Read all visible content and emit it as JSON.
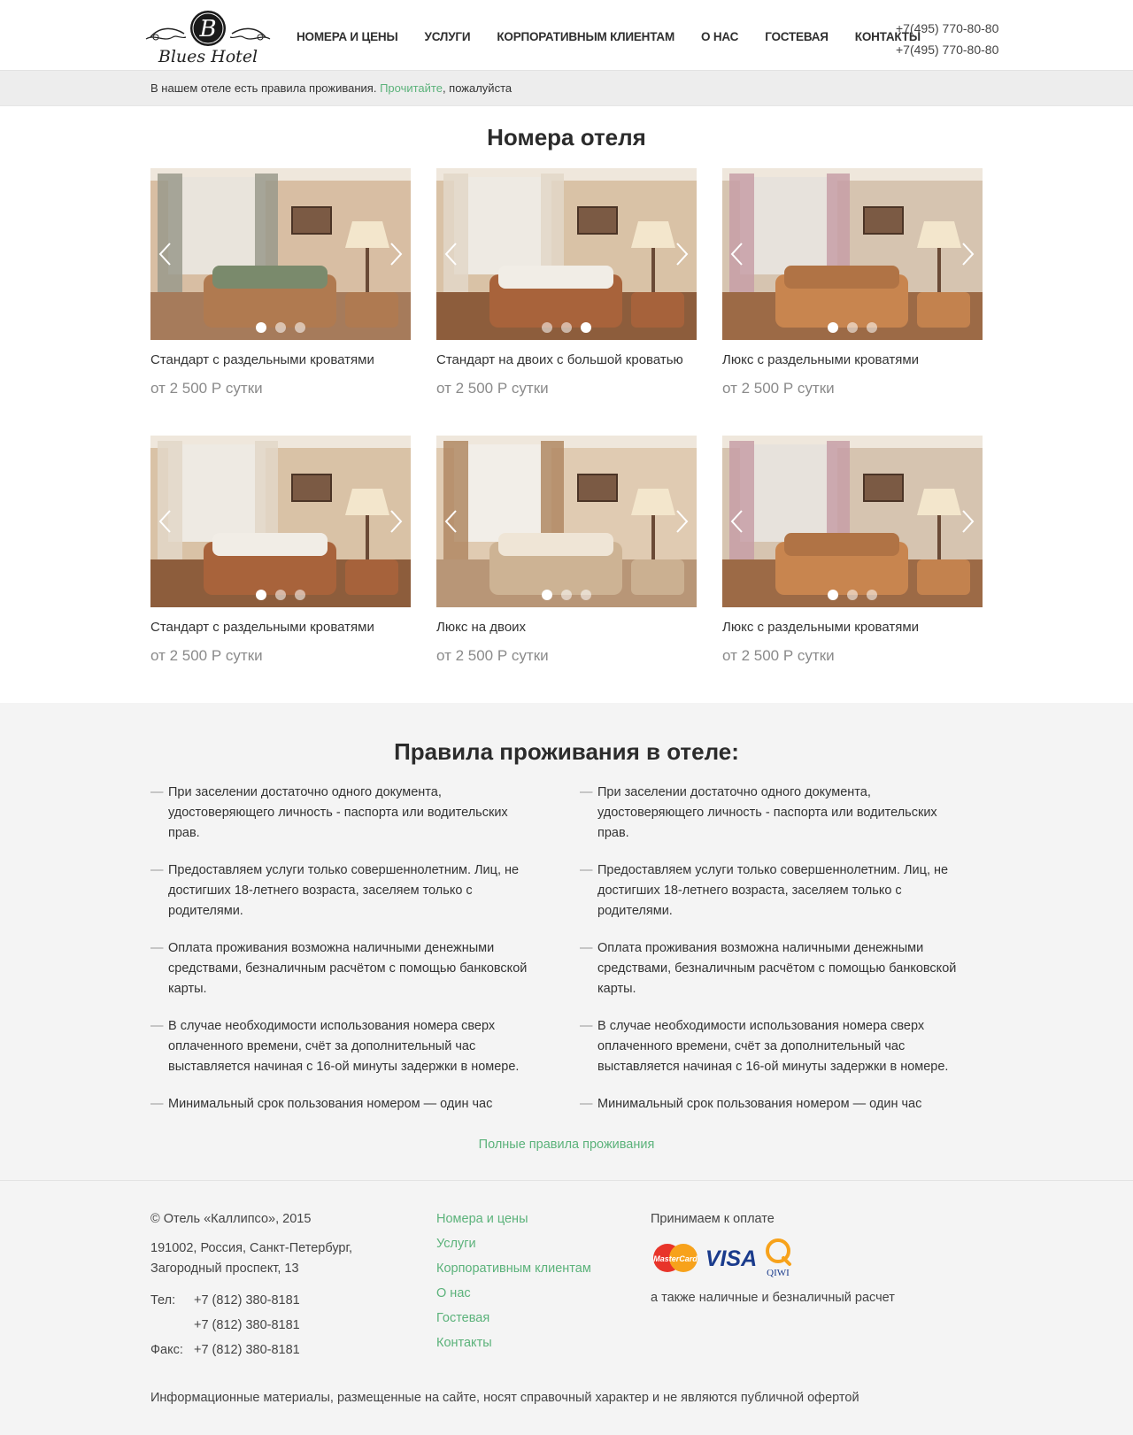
{
  "header": {
    "logo_text": "Blues Hotel",
    "logo_letter": "B",
    "nav": [
      {
        "label": "Номера и цены"
      },
      {
        "label": "Услуги"
      },
      {
        "label": "Корпоративным клиентам"
      },
      {
        "label": "О нас"
      },
      {
        "label": "Гостевая"
      },
      {
        "label": "Контакты"
      }
    ],
    "phones": [
      "+7(495) 770-80-80",
      "+7(495) 770-80-80"
    ]
  },
  "notice": {
    "text_before": "В нашем отеле есть правила проживания. ",
    "link": "Прочитайте",
    "text_after": ", пожалуйста"
  },
  "rooms": {
    "title": "Номера отеля",
    "items": [
      {
        "name": "Стандарт с раздельными кроватями",
        "price": "от 2 500 Р сутки",
        "active_dot": 0
      },
      {
        "name": "Стандарт на двоих с большой кроватью",
        "price": "от 2 500 Р сутки",
        "active_dot": 2
      },
      {
        "name": "Люкс с раздельными кроватями",
        "price": "от 2 500 Р сутки",
        "active_dot": 0
      },
      {
        "name": "Стандарт с раздельными кроватями",
        "price": "от 2 500 Р сутки",
        "active_dot": 0
      },
      {
        "name": "Люкс на двоих",
        "price": "от 2 500 Р сутки",
        "active_dot": 0
      },
      {
        "name": "Люкс с раздельными кроватями",
        "price": "от 2 500 Р сутки",
        "active_dot": 0
      }
    ]
  },
  "rules": {
    "title": "Правила проживания в отеле:",
    "left": [
      "При заселении достаточно одного документа, удостоверяющего личность - паспорта или водительских прав.",
      "Предоставляем услуги только совершеннолетним. Лиц, не достигших 18-летнего возраста, заселяем только с родителями.",
      "Оплата проживания возможна наличными денежными средствами, безналичным расчётом с помощью банковской карты.",
      "В случае необходимости использования номера сверх оплаченного времени, счёт за дополнительный час выставляется начиная с 16-ой минуты задержки в номере.",
      "Минимальный срок пользования номером — один час"
    ],
    "right": [
      "При заселении достаточно одного документа, удостоверяющего личность - паспорта или водительских прав.",
      "Предоставляем услуги только совершеннолетним. Лиц, не достигших 18-летнего возраста, заселяем только с родителями.",
      "Оплата проживания возможна наличными денежными средствами, безналичным расчётом с помощью банковской карты.",
      "В случае необходимости использования номера сверх оплаченного времени, счёт за дополнительный час выставляется начиная с 16-ой минуты задержки в номере.",
      "Минимальный срок пользования номером — один час"
    ],
    "full_link": "Полные правила проживания"
  },
  "footer": {
    "copyright": "© Отель «Каллипсо», 2015",
    "address_line1": "191002, Россия, Санкт-Петербург,",
    "address_line2": "Загородный проспект, 13",
    "tel_label": "Тел:",
    "tel1": "+7 (812) 380-8181",
    "tel2": "+7 (812) 380-8181",
    "fax_label": "Факс:",
    "fax": "+7 (812) 380-8181",
    "links": [
      "Номера и цены",
      "Услуги",
      "Корпоративным клиентам",
      "О нас",
      "Гостевая",
      "Контакты"
    ],
    "pay_title": "Принимаем к оплате",
    "pay_logos": {
      "mastercard": "MasterCard",
      "visa": "VISA",
      "qiwi": "QIWI"
    },
    "pay_note": "а также наличные и безналичный расчет",
    "disclaimer": "Информационные материалы, размещенные на сайте, носят справочный характер и не являются публичной офертой"
  },
  "colors": {
    "accent_green": "#5bb27a",
    "text_dark": "#333333",
    "price_gray": "#8a8a8a",
    "section_bg": "#f4f4f4"
  }
}
